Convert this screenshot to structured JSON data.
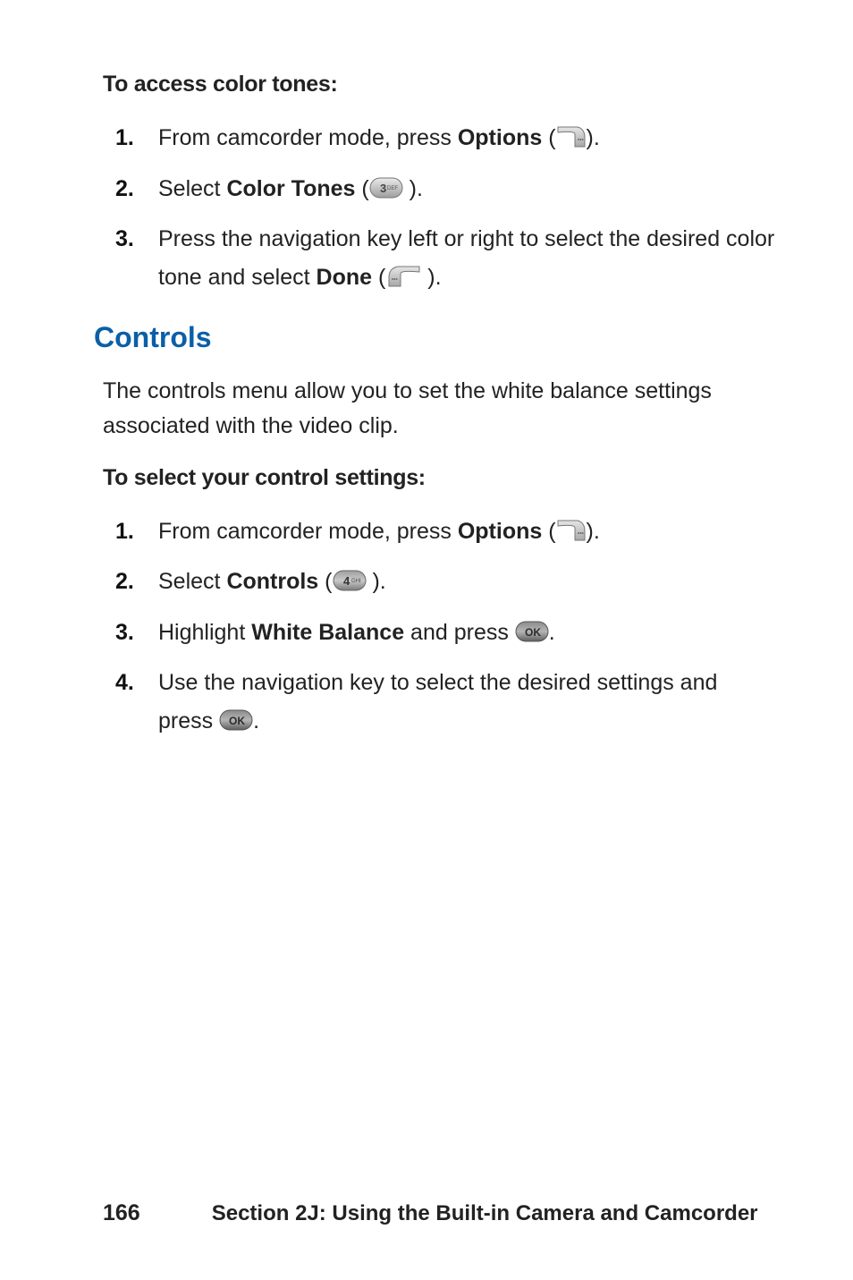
{
  "headings": {
    "access_color_tones": "To access color tones:",
    "controls": "Controls",
    "select_control_settings": "To select your control settings:"
  },
  "controls_desc": "The controls menu allow you to set the white balance settings associated with the video clip.",
  "color_tones_steps": [
    {
      "num": "1.",
      "pre": "From camcorder mode, press ",
      "bold": "Options",
      "post_open": " (",
      "icon": "softkey-right",
      "post_close": ")."
    },
    {
      "num": "2.",
      "pre": "Select ",
      "bold": "Color Tones",
      "post_open": " (",
      "icon": "numkey-3",
      "post_close": " )."
    },
    {
      "num": "3.",
      "pre": "Press the navigation key left or right to select the desired color tone and select ",
      "bold": "Done",
      "post_open": " (",
      "icon": "softkey-left",
      "post_close": " )."
    }
  ],
  "controls_steps": [
    {
      "num": "1.",
      "pre": "From camcorder mode, press ",
      "bold": "Options",
      "post_open": " (",
      "icon": "softkey-right",
      "post_close": ")."
    },
    {
      "num": "2.",
      "pre": "Select ",
      "bold": "Controls",
      "post_open": " (",
      "icon": "numkey-4",
      "post_close": " )."
    },
    {
      "num": "3.",
      "pre": "Highlight ",
      "bold": "White Balance",
      "post": " and press ",
      "icon": "okkey",
      "tail": "."
    },
    {
      "num": "4.",
      "pre": "Use the navigation key to select the desired settings and press ",
      "icon": "okkey",
      "tail": "."
    }
  ],
  "footer": {
    "page_number": "166",
    "section": "Section 2J: Using the Built-in Camera and Camcorder"
  },
  "icons": {
    "numkey-3": "3",
    "numkey-4": "4",
    "okkey": "OK"
  }
}
